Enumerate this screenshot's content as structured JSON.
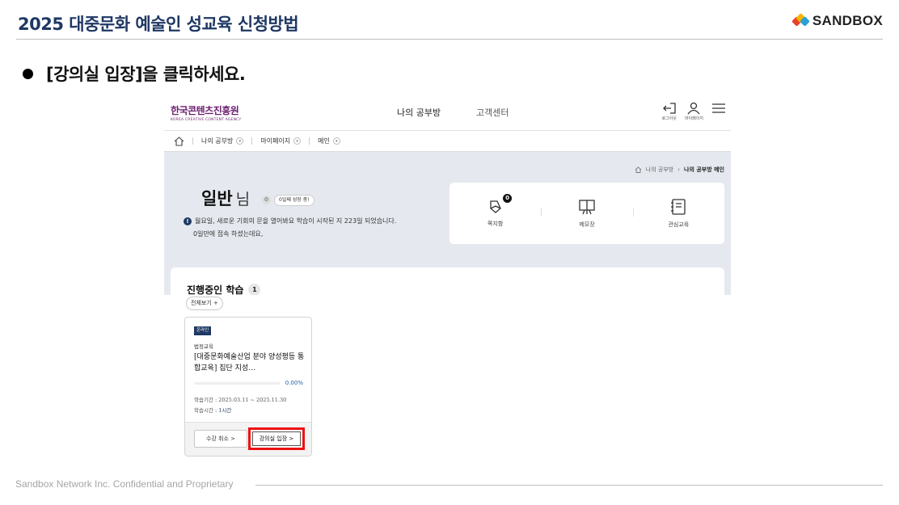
{
  "slide": {
    "title": "2025 대중문화 예술인 성교육 신청방법",
    "logo_text": "SANDBOX",
    "instruction": "[강의실 입장]을 클릭하세요.",
    "footer": "Sandbox Network Inc. Confidential and Proprietary"
  },
  "site": {
    "org_name": "한국콘텐츠진흥원",
    "org_name_en": "KOREA CREATIVE CONTENT AGENCY",
    "nav": [
      "나의 공부방",
      "고객센터"
    ],
    "top_icons": [
      {
        "icon": "logout-icon",
        "label": "로그아웃"
      },
      {
        "icon": "user-icon",
        "label": "마이페이지"
      },
      {
        "icon": "menu-icon",
        "label": ""
      }
    ],
    "breadcrumb": [
      "나의 공부방",
      "마이페이지",
      "메인"
    ],
    "path": [
      "나의 공부방",
      "나의 공부방 메인"
    ]
  },
  "profile": {
    "name": "일반",
    "honorific": "님",
    "growth_badge": "0일째 성장 중!",
    "info_line": "월요일, 새로운 기회의 문을 열어봐요 학습이 시작된 지 223일 되었습니다.",
    "info_line2": "0일만에 접속 하셨는데요,"
  },
  "quick": [
    {
      "icon": "note-icon",
      "label": "쪽지함",
      "badge": "0"
    },
    {
      "icon": "memo-board-icon",
      "label": "메모장"
    },
    {
      "icon": "notebook-icon",
      "label": "관심교육"
    }
  ],
  "learning": {
    "title": "진행중인 학습",
    "count": "1",
    "view_all": "전체보기 +"
  },
  "course": {
    "tag": "온라인",
    "category": "법정교육",
    "name": "[대중문화예술산업 분야 양성평등 통합교육] 집단 지성…",
    "progress_label": "0.00%",
    "progress": 0,
    "period": "학습기간 : 2025.03.11 ~ 2025.11.30",
    "time_label": "학습시간 :",
    "time_value": "1시간",
    "cancel_button": "수강 취소 >",
    "enter_button": "강의실 입장 >"
  },
  "colors": {
    "title": "#1f3864",
    "highlight": "#ee1111",
    "brand": "#6b1f6f"
  }
}
